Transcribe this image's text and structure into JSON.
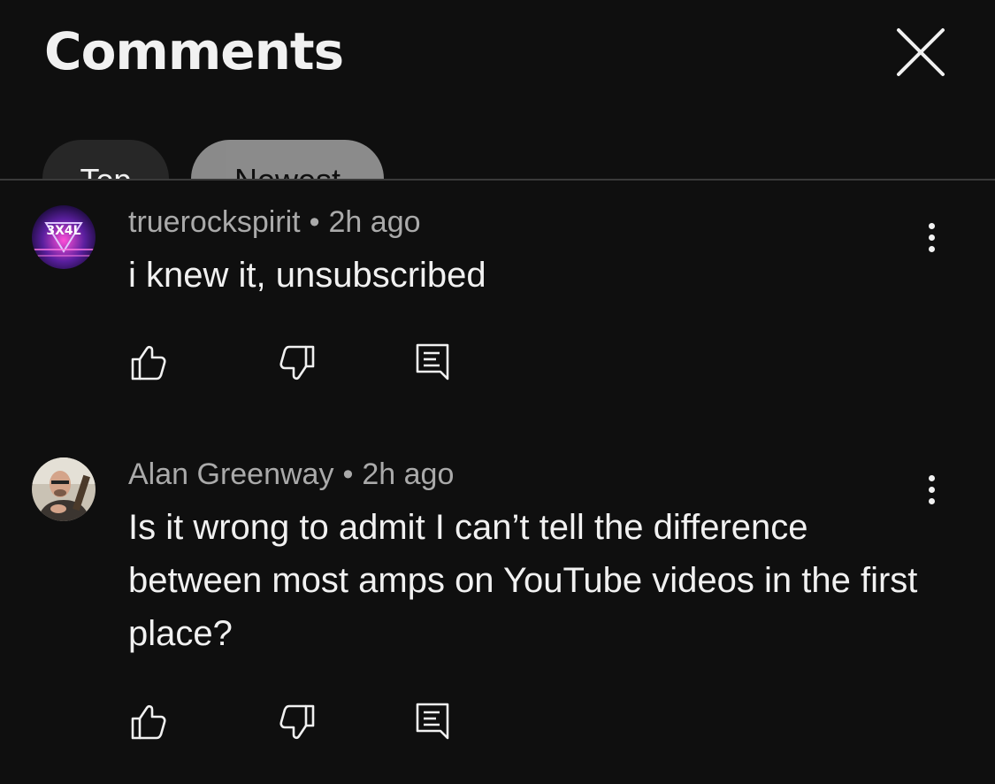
{
  "header": {
    "title": "Comments",
    "close_icon": "close-icon",
    "chips": [
      {
        "label": "Top"
      },
      {
        "label": "Newest"
      }
    ]
  },
  "comments": [
    {
      "author": "truerockspirit",
      "separator": "•",
      "time": "2h ago",
      "text": "i knew it, unsubscribed",
      "avatar_text": "3X4L"
    },
    {
      "author": "Alan Greenway",
      "separator": "•",
      "time": "2h ago",
      "text": "Is it wrong to admit I can’t tell the difference between most amps on YouTube videos in the first place?"
    }
  ],
  "colors": {
    "background": "#0f0f0f",
    "text_primary": "#f1f1f1",
    "text_secondary": "#aaaaaa",
    "chip_dark": "#272727"
  },
  "icons": [
    "close-icon",
    "more-vert-icon",
    "thumb-up-icon",
    "thumb-down-icon",
    "reply-icon"
  ]
}
